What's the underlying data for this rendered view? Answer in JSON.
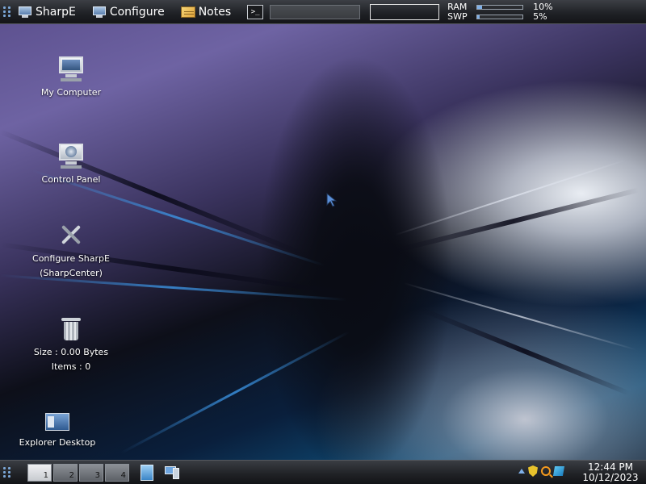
{
  "top_panel": {
    "menus": [
      {
        "label": "SharpE",
        "icon": "monitor-icon"
      },
      {
        "label": "Configure",
        "icon": "monitor-icon"
      },
      {
        "label": "Notes",
        "icon": "notes-icon"
      }
    ],
    "terminal_glyph": ">_",
    "run_input_value": "",
    "ram": {
      "label": "RAM",
      "percent_text": "10%",
      "value": 10
    },
    "swap": {
      "label": "SWP",
      "percent_text": "5%",
      "value": 5
    }
  },
  "desktop": {
    "icons": [
      {
        "label": "My Computer",
        "icon": "computer-icon"
      },
      {
        "label": "Control Panel",
        "icon": "control-panel-icon"
      },
      {
        "label_line1": "Configure SharpE",
        "label_line2": "(SharpCenter)",
        "icon": "tools-icon"
      },
      {
        "label_line1": "Size : 0.00 Bytes",
        "label_line2": "Items : 0",
        "icon": "trash-icon"
      },
      {
        "label": "Explorer Desktop",
        "icon": "explorer-icon"
      }
    ]
  },
  "bottom_panel": {
    "desktops": [
      "1",
      "2",
      "3",
      "4"
    ],
    "active_desktop": 0,
    "task_icons": [
      "notepad-icon",
      "computer-task-icon"
    ],
    "tray_icons": [
      "tray-expand-icon",
      "shield-icon",
      "search-icon",
      "network-icon"
    ],
    "clock": {
      "time": "12:44 PM",
      "date": "10/12/2023"
    }
  },
  "colors": {
    "panel_bg": "#1e2024",
    "accent": "#7fb0e8",
    "wallpaper_purple": "#5a4e8c",
    "wallpaper_blue": "#0f4f7a"
  }
}
